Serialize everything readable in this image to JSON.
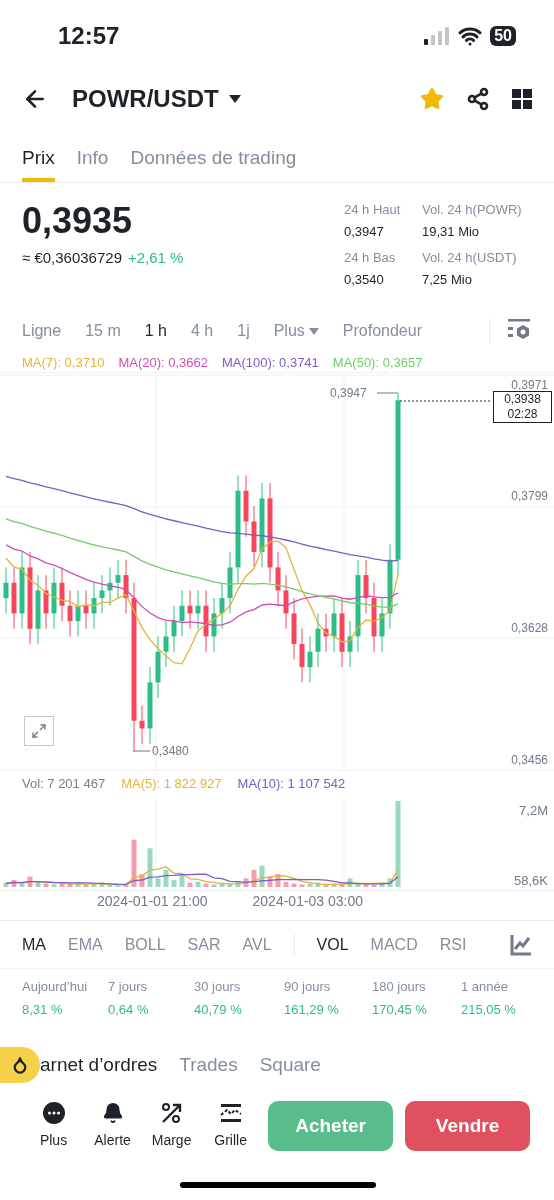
{
  "status_bar": {
    "time": "12:57",
    "battery": "50"
  },
  "header": {
    "title": "POWR/USDT",
    "favorite": true
  },
  "tabs": [
    {
      "label": "Prix",
      "selected": true
    },
    {
      "label": "Info",
      "selected": false
    },
    {
      "label": "Données de trading",
      "selected": false
    }
  ],
  "price": {
    "last": "0,3935",
    "fiat": "≈ €0,36036729",
    "change": "+2,61 %"
  },
  "stats": [
    {
      "label": "24 h Haut",
      "value": "0,3947"
    },
    {
      "label": "Vol. 24 h(POWR)",
      "value": "19,31 Mio"
    },
    {
      "label": "24 h Bas",
      "value": "0,3540"
    },
    {
      "label": "Vol. 24 h(USDT)",
      "value": "7,25 Mio"
    }
  ],
  "intervals": [
    {
      "label": "Ligne",
      "selected": false,
      "kind": "plain"
    },
    {
      "label": "15 m",
      "selected": false,
      "kind": "plain"
    },
    {
      "label": "1 h",
      "selected": true,
      "kind": "plain"
    },
    {
      "label": "4 h",
      "selected": false,
      "kind": "plain"
    },
    {
      "label": "1j",
      "selected": false,
      "kind": "plain"
    },
    {
      "label": "Plus",
      "selected": false,
      "kind": "dropdown"
    },
    {
      "label": "Profondeur",
      "selected": false,
      "kind": "plain"
    }
  ],
  "ma_legend": [
    {
      "label": "MA(7): 0,3710",
      "color": "#e3b43a"
    },
    {
      "label": "MA(20): 0,3662",
      "color": "#d24bb0"
    },
    {
      "label": "MA(100): 0,3741",
      "color": "#7d5cc4"
    },
    {
      "label": "MA(50): 0,3657",
      "color": "#6fcf6a"
    }
  ],
  "price_axis": [
    "0,3971",
    "0,3799",
    "0,3628",
    "0,3456"
  ],
  "chart_labels": {
    "high": "0,3947",
    "low": "0,3480",
    "current_price": "0,3938",
    "countdown": "02:28"
  },
  "volume_legend": [
    {
      "label": "Vol: 7 201 467",
      "color": "#7a828e"
    },
    {
      "label": "MA(5): 1 822 927",
      "color": "#e3b43a"
    },
    {
      "label": "MA(10): 1 107 542",
      "color": "#7d5cc4"
    }
  ],
  "volume_axis": [
    "7,2M",
    "58,6K"
  ],
  "time_axis": [
    "2024-01-01 21:00",
    "2024-01-03 03:00"
  ],
  "main_indicators": [
    {
      "label": "MA",
      "selected": true
    },
    {
      "label": "EMA",
      "selected": false
    },
    {
      "label": "BOLL",
      "selected": false
    },
    {
      "label": "SAR",
      "selected": false
    },
    {
      "label": "AVL",
      "selected": false
    }
  ],
  "sub_indicators": [
    {
      "label": "VOL",
      "selected": true
    },
    {
      "label": "MACD",
      "selected": false
    },
    {
      "label": "RSI",
      "selected": false
    }
  ],
  "performance": [
    {
      "period": "Aujourd’hui",
      "value": "8,31 %"
    },
    {
      "period": "7 jours",
      "value": "0,64 %"
    },
    {
      "period": "30 jours",
      "value": "40,79 %"
    },
    {
      "period": "90 jours",
      "value": "161,29 %"
    },
    {
      "period": "180 jours",
      "value": "170,45 %"
    },
    {
      "period": "1 année",
      "value": "215,05 %"
    }
  ],
  "bottom_tabs": [
    {
      "label": "arnet d’ordres",
      "selected": true
    },
    {
      "label": "Trades",
      "selected": false
    },
    {
      "label": "Square",
      "selected": false
    }
  ],
  "actions": [
    {
      "label": "Plus",
      "kind": "more"
    },
    {
      "label": "Alerte",
      "kind": "bell"
    },
    {
      "label": "Marge",
      "kind": "percent"
    },
    {
      "label": "Grille",
      "kind": "grid"
    }
  ],
  "buy_button": "Acheter",
  "sell_button": "Vendre"
}
